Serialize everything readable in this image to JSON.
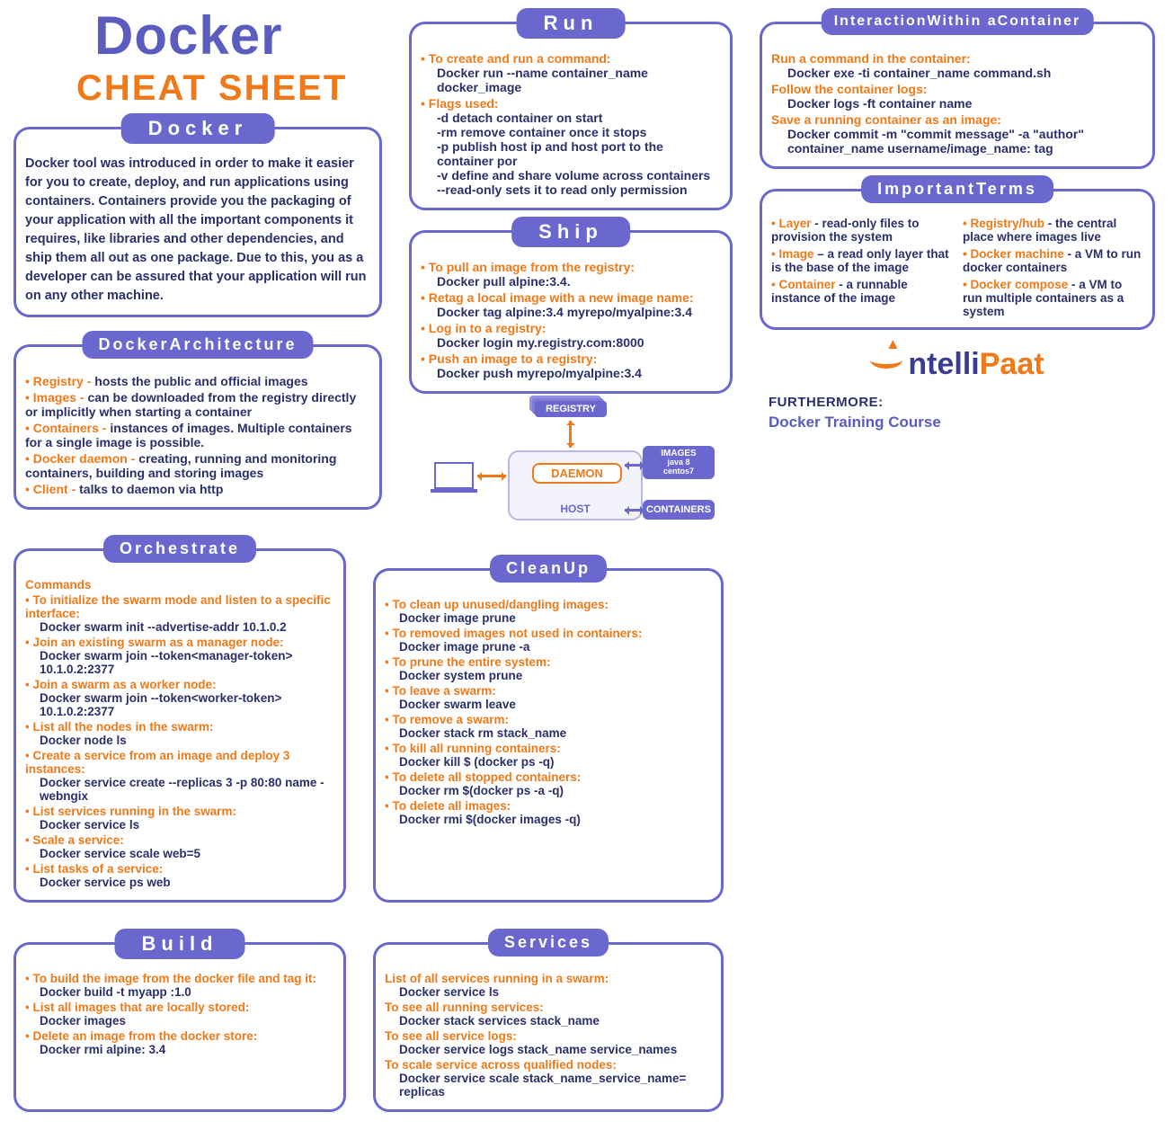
{
  "title": {
    "main": "Docker",
    "sub": "CHEAT SHEET"
  },
  "docker": {
    "heading": "Docker",
    "para": "Docker tool was introduced in order to make it easier for you to create, deploy, and run applications using containers. Containers provide you the packaging of your application with all the important components it requires, like libraries and other dependencies, and ship them all out as one package. Due to this, you as a developer can be assured that your application will run on any other machine."
  },
  "arch": {
    "heading": "DockerArchitecture",
    "items": [
      {
        "label": "Registry -",
        "desc": " hosts the public and official images"
      },
      {
        "label": "Images -",
        "desc": " can be downloaded from the registry directly or implicitly when starting a container"
      },
      {
        "label": "Containers -",
        "desc": " instances of images. Multiple containers for a single image is possible."
      },
      {
        "label": "Docker daemon -",
        "desc": " creating, running and monitoring containers, building and storing images"
      },
      {
        "label": "Client -",
        "desc": " talks to daemon via http"
      }
    ]
  },
  "run": {
    "heading": "Run",
    "items": [
      {
        "label": "To create and run a command:",
        "cmd": "Docker run --name container_name docker_image"
      },
      {
        "label": "Flags used:",
        "cmds": [
          "-d detach container on start",
          "-rm remove container once it stops",
          "-p publish host ip and host port to the container por",
          "-v define and share volume across containers",
          "--read-only sets it to read only permission"
        ]
      }
    ]
  },
  "ship": {
    "heading": "Ship",
    "items": [
      {
        "label": "To pull an image from the registry:",
        "cmd": "Docker pull alpine:3.4."
      },
      {
        "label": "Retag a local image with a new image name:",
        "cmd": "Docker tag alpine:3.4 myrepo/myalpine:3.4"
      },
      {
        "label": "Log in to a registry:",
        "cmd": "Docker login my.registry.com:8000"
      },
      {
        "label": "Push an image to a registry:",
        "cmd": "Docker push myrepo/myalpine:3.4"
      }
    ]
  },
  "interact": {
    "heading": "InteractionWithin aContainer",
    "items": [
      {
        "label": "Run a command in the container:",
        "cmd": "Docker exe -ti container_name command.sh"
      },
      {
        "label": "Follow the container logs:",
        "cmd": "Docker logs -ft container name"
      },
      {
        "label": "Save a running container as an image:",
        "cmds": [
          "Docker commit -m \"commit message\" -a \"author\"",
          "container_name username/image_name: tag"
        ]
      }
    ]
  },
  "terms": {
    "heading": "ImportantTerms",
    "left": [
      {
        "label": "Layer",
        "desc": " - read-only files to provision the system"
      },
      {
        "label": "Image",
        "desc": " – a read only layer that is the base of the image"
      },
      {
        "label": "Container",
        "desc": " - a runnable instance of the image"
      }
    ],
    "right": [
      {
        "label": "Registry/hub",
        "desc": " - the central place where images live"
      },
      {
        "label": "Docker machine",
        "desc": " - a VM to run docker containers"
      },
      {
        "label": "Docker compose",
        "desc": " - a VM to run multiple containers as a system"
      }
    ]
  },
  "diagram": {
    "registry": "REGISTRY",
    "daemon": "DAEMON",
    "host": "HOST",
    "images": "IMAGES",
    "img_sub1": "java 8",
    "img_sub2": "centos7",
    "containers": "CONTAINERS"
  },
  "logo": {
    "p1": "ntelli",
    "p2": "Paat"
  },
  "further": {
    "l1": "FURTHERMORE:",
    "l2": "Docker Training Course"
  },
  "orchestrate": {
    "heading": "Orchestrate",
    "sub": "Commands",
    "items": [
      {
        "label": "To initialize the swarm mode and listen to a specific interface:",
        "cmd": "Docker swarm init --advertise-addr 10.1.0.2"
      },
      {
        "label": "Join an existing swarm as a manager node:",
        "cmd": "Docker swarm join --token<manager-token> 10.1.0.2:2377"
      },
      {
        "label": "Join a swarm as a worker node:",
        "cmd": "Docker swarm join --token<worker-token> 10.1.0.2:2377"
      },
      {
        "label": "List all the nodes in the swarm:",
        "cmd": "Docker node ls"
      },
      {
        "label": "Create a service from an image and deploy 3 instances:",
        "cmd": "Docker service create --replicas 3 -p 80:80 name -webngix"
      },
      {
        "label": "List services running in the swarm:",
        "cmd": "Docker service ls"
      },
      {
        "label": "Scale a service:",
        "cmd": "Docker service scale web=5"
      },
      {
        "label": "List tasks of a service:",
        "cmd": "Docker service ps web"
      }
    ]
  },
  "cleanup": {
    "heading": "CleanUp",
    "items": [
      {
        "label": "To clean up unused/dangling images:",
        "cmd": "Docker image prune"
      },
      {
        "label": "To removed images not used in containers:",
        "cmd": "Docker image prune -a"
      },
      {
        "label": "To prune the entire system:",
        "cmd": "Docker system prune"
      },
      {
        "label": "To leave a swarm:",
        "cmd": "Docker swarm leave"
      },
      {
        "label": "To remove a swarm:",
        "cmd": "Docker stack rm stack_name"
      },
      {
        "label": "To kill all running containers:",
        "cmd": "Docker kill $ (docker ps -q)"
      },
      {
        "label": "To delete all stopped containers:",
        "cmd": "Docker rm $(docker ps -a -q)"
      },
      {
        "label": "To delete all images:",
        "cmd": "Docker rmi $(docker images -q)"
      }
    ]
  },
  "build": {
    "heading": "Build",
    "items": [
      {
        "label": "To build the image from the docker file and tag it:",
        "cmd": "Docker build -t myapp :1.0"
      },
      {
        "label": "List all images that are locally stored:",
        "cmd": "Docker images"
      },
      {
        "label": "Delete an image from the docker store:",
        "cmd": "Docker rmi alpine: 3.4"
      }
    ]
  },
  "services": {
    "heading": "Services",
    "items": [
      {
        "label": "List of all services running in a swarm:",
        "cmd": "Docker service ls"
      },
      {
        "label": "To see all running services:",
        "cmd": "Docker stack services stack_name"
      },
      {
        "label": "To see all service logs:",
        "cmd": "Docker service logs stack_name service_names"
      },
      {
        "label": "To scale service across qualified nodes:",
        "cmd": "Docker service scale stack_name_service_name= replicas"
      }
    ]
  }
}
